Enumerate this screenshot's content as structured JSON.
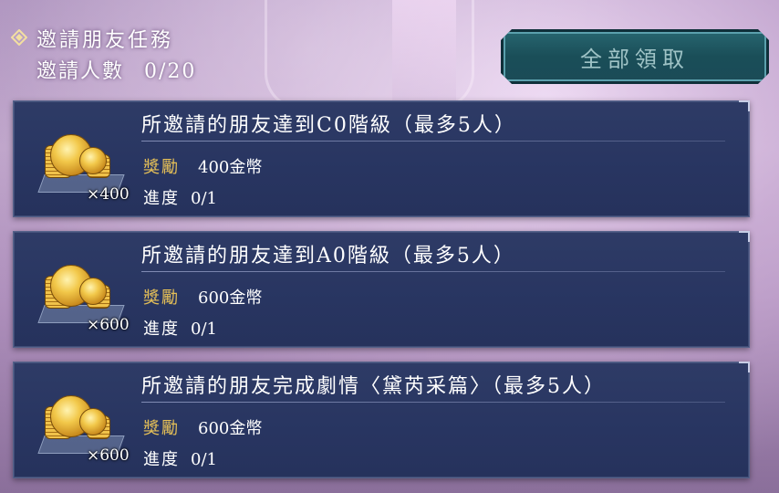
{
  "header": {
    "title": "邀請朋友任務",
    "invite_label": "邀請人數",
    "invite_count": "0/20",
    "icon": "diamond-icon"
  },
  "claim_all_label": "全部領取",
  "tasks": [
    {
      "title": "所邀請的朋友達到C0階級（最多5人）",
      "reward_label": "獎勵",
      "reward_value": "400金幣",
      "progress_label": "進度",
      "progress_value": "0/1",
      "item_qty": "×400",
      "icon": "gold-coins-icon"
    },
    {
      "title": "所邀請的朋友達到A0階級（最多5人）",
      "reward_label": "獎勵",
      "reward_value": "600金幣",
      "progress_label": "進度",
      "progress_value": "0/1",
      "item_qty": "×600",
      "icon": "gold-coins-icon"
    },
    {
      "title": "所邀請的朋友完成劇情〈黛芮采篇〉（最多5人）",
      "reward_label": "獎勵",
      "reward_value": "600金幣",
      "progress_label": "進度",
      "progress_value": "0/1",
      "item_qty": "×600",
      "icon": "gold-coins-icon"
    }
  ],
  "colors": {
    "card_bg": "#2b3862",
    "reward_label": "#e6c057",
    "button_bg": "#1f5862",
    "button_text": "#9fc3c6"
  }
}
